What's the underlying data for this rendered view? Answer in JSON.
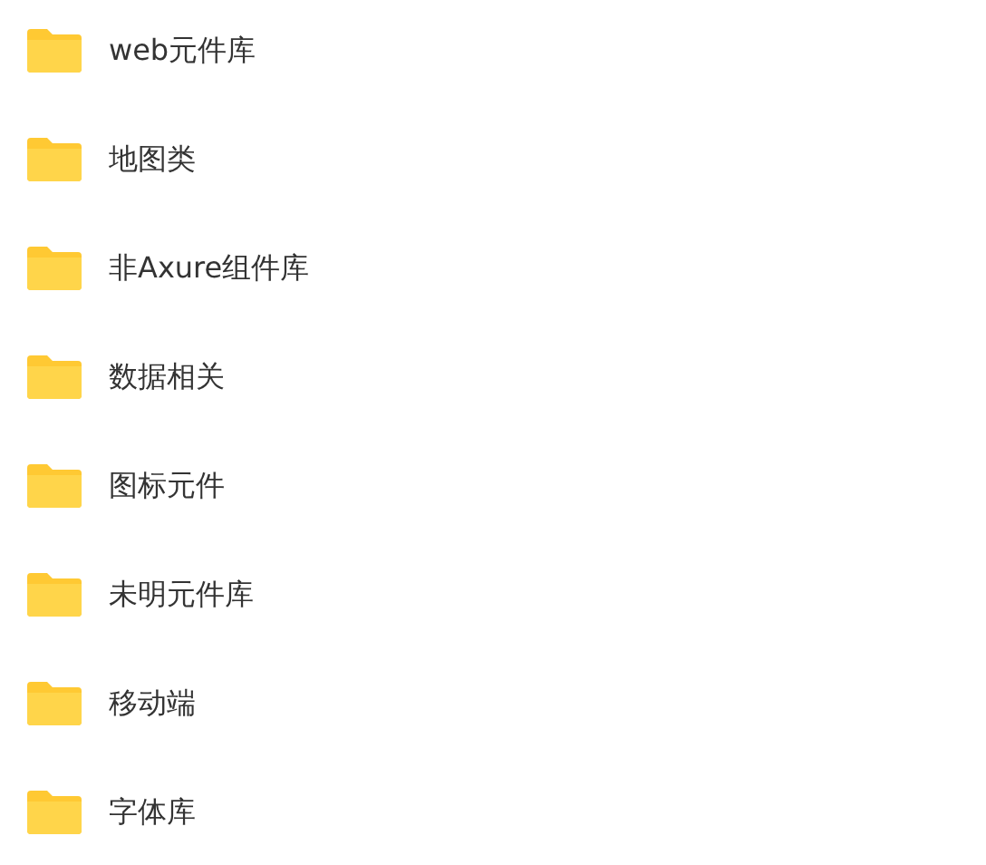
{
  "folders": [
    {
      "name": "web元件库"
    },
    {
      "name": "地图类"
    },
    {
      "name": "非Axure组件库"
    },
    {
      "name": "数据相关"
    },
    {
      "name": "图标元件"
    },
    {
      "name": "未明元件库"
    },
    {
      "name": "移动端"
    },
    {
      "name": "字体库"
    }
  ]
}
